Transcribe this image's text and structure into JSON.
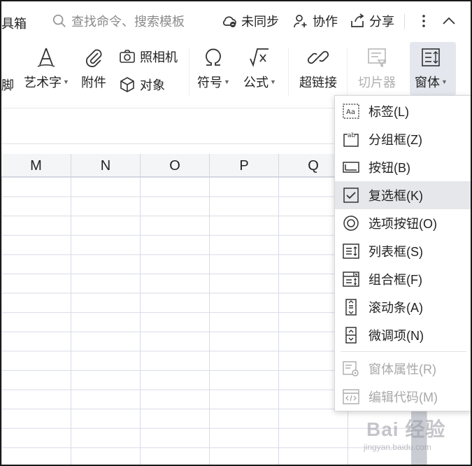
{
  "topbar": {
    "partial_label": "具箱",
    "search_placeholder": "查找命令、搜索模板",
    "sync_label": "未同步",
    "collab_label": "协作",
    "share_label": "分享"
  },
  "ribbon": {
    "partial_left_label": "脚",
    "wordart_label": "艺术字",
    "attachment_label": "附件",
    "camera_label": "照相机",
    "object_label": "对象",
    "symbol_label": "符号",
    "formula_label": "公式",
    "hyperlink_label": "超链接",
    "slicer_label": "切片器",
    "window_label": "窗体"
  },
  "grid": {
    "columns": [
      "M",
      "N",
      "O",
      "P",
      "Q"
    ]
  },
  "menu": {
    "items": [
      {
        "label": "标签(L)",
        "icon": "label-icon",
        "state": "normal"
      },
      {
        "label": "分组框(Z)",
        "icon": "group-box-icon",
        "state": "normal"
      },
      {
        "label": "按钮(B)",
        "icon": "button-icon",
        "state": "normal"
      },
      {
        "label": "复选框(K)",
        "icon": "checkbox-icon",
        "state": "hover"
      },
      {
        "label": "选项按钮(O)",
        "icon": "radio-button-icon",
        "state": "normal"
      },
      {
        "label": "列表框(S)",
        "icon": "list-box-icon",
        "state": "normal"
      },
      {
        "label": "组合框(F)",
        "icon": "combo-box-icon",
        "state": "normal"
      },
      {
        "label": "滚动条(A)",
        "icon": "scrollbar-icon",
        "state": "normal"
      },
      {
        "label": "微调项(N)",
        "icon": "spinner-icon",
        "state": "normal"
      },
      {
        "label": "窗体属性(R)",
        "icon": "form-properties-icon",
        "state": "disabled"
      },
      {
        "label": "编辑代码(M)",
        "icon": "edit-code-icon",
        "state": "disabled"
      }
    ]
  },
  "watermark": {
    "text": "Bai 经验",
    "url": "jingyan.baidu.com"
  },
  "colors": {
    "hover_bg": "#e5e7eb",
    "active_button_bg": "#e4e7ee",
    "disabled_text": "#a8a8a8",
    "grid_line": "#d9dbe6"
  }
}
